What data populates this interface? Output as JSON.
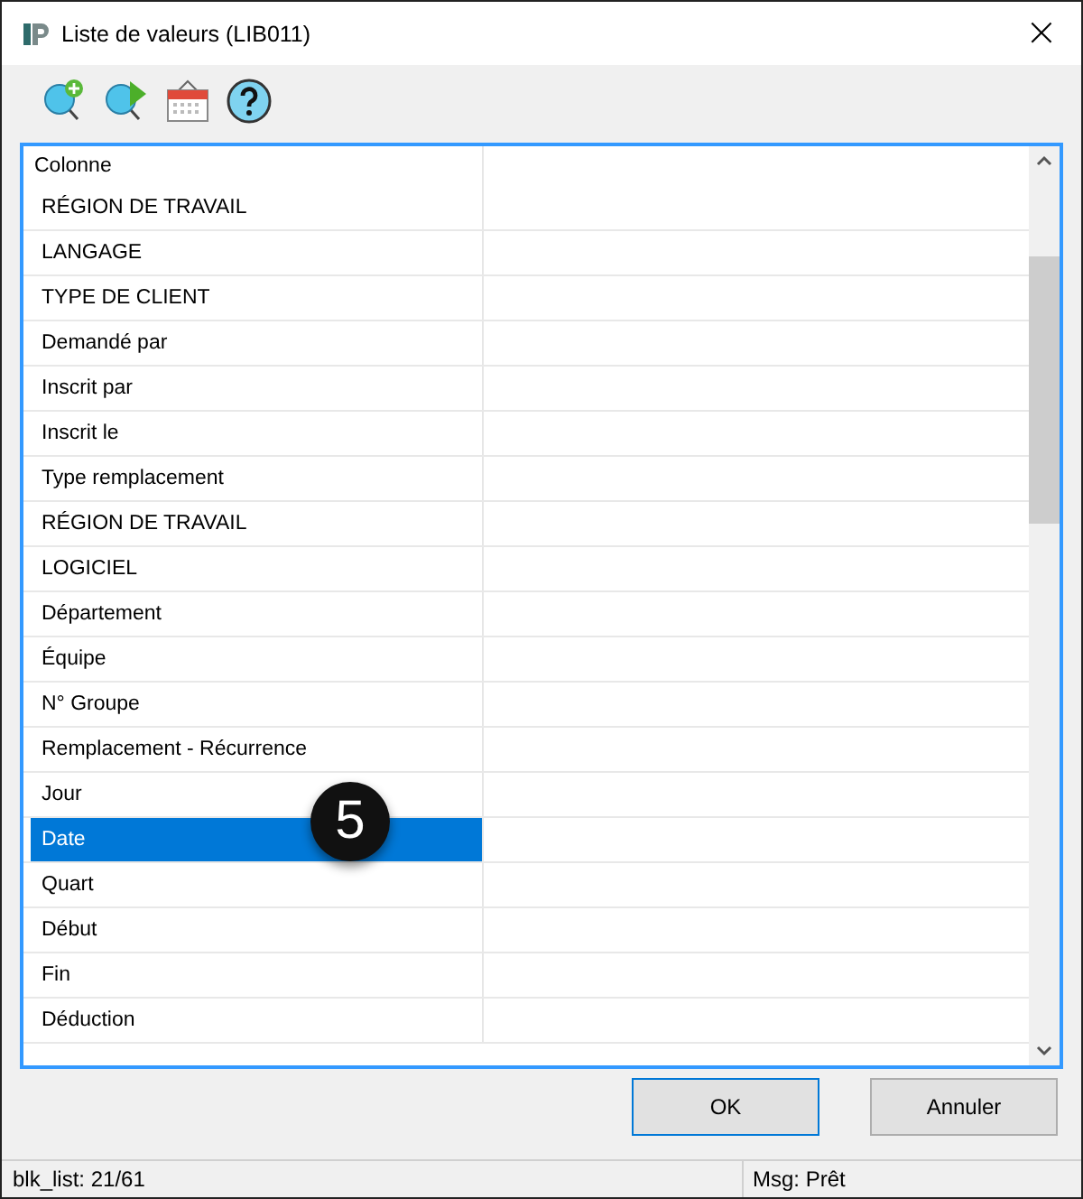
{
  "window": {
    "title": "Liste de valeurs (LIB011)",
    "close": "×"
  },
  "list": {
    "column_header": "Colonne",
    "rows": [
      {
        "label": "RÉGION DE TRAVAIL",
        "selected": false
      },
      {
        "label": "LANGAGE",
        "selected": false
      },
      {
        "label": "TYPE DE CLIENT",
        "selected": false
      },
      {
        "label": "Demandé par",
        "selected": false
      },
      {
        "label": "Inscrit par",
        "selected": false
      },
      {
        "label": "Inscrit le",
        "selected": false
      },
      {
        "label": "Type remplacement",
        "selected": false
      },
      {
        "label": "RÉGION DE TRAVAIL",
        "selected": false
      },
      {
        "label": "LOGICIEL",
        "selected": false
      },
      {
        "label": "Département",
        "selected": false
      },
      {
        "label": "Équipe",
        "selected": false
      },
      {
        "label": "N° Groupe",
        "selected": false
      },
      {
        "label": "Remplacement - Récurrence",
        "selected": false
      },
      {
        "label": "Jour",
        "selected": false
      },
      {
        "label": "Date",
        "selected": true
      },
      {
        "label": "Quart",
        "selected": false
      },
      {
        "label": "Début",
        "selected": false
      },
      {
        "label": "Fin",
        "selected": false
      },
      {
        "label": "Déduction",
        "selected": false
      }
    ]
  },
  "step_badge": "5",
  "buttons": [
    {
      "label": "OK",
      "default": true
    },
    {
      "label": "Annuler",
      "default": false
    }
  ],
  "status_bar": {
    "record": "blk_list: 21/61",
    "message": "Msg: Prêt"
  }
}
